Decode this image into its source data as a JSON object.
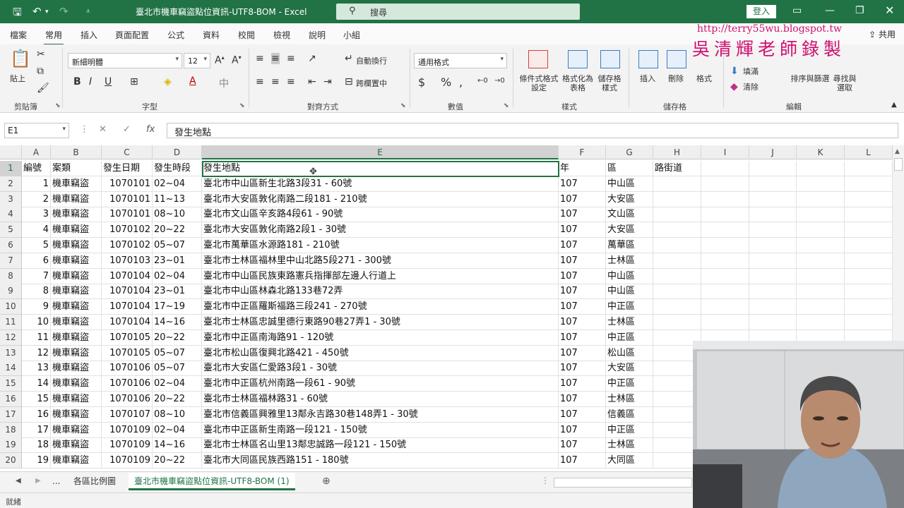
{
  "titlebar": {
    "title": "臺北市機車竊盜點位資訊-UTF8-BOM  -  Excel",
    "search_placeholder": "搜尋",
    "login": "登入"
  },
  "tabs": [
    "檔案",
    "常用",
    "插入",
    "頁面配置",
    "公式",
    "資料",
    "校閱",
    "檢視",
    "說明",
    "小組"
  ],
  "share": "共用",
  "ribbon": {
    "paste": "貼上",
    "clipboard": "剪貼簿",
    "font_name": "新細明體",
    "font_size": "12",
    "font_group": "字型",
    "wrap_text": "自動換行",
    "merge_center": "跨欄置中",
    "alignment": "對齊方式",
    "number_format": "通用格式",
    "number": "數值",
    "cond_format": "條件式格式設定",
    "format_table": "格式化為表格",
    "cell_styles": "儲存格樣式",
    "styles": "樣式",
    "insert": "插入",
    "delete": "刪除",
    "format": "格式",
    "cells": "儲存格",
    "fill": "填滿",
    "clear": "清除",
    "sort_filter": "排序與篩選",
    "find_select": "尋找與選取",
    "editing": "編輯"
  },
  "watermark": {
    "url": "http://terry55wu.blogspot.tw",
    "text": "吳清輝老師錄製"
  },
  "formula_bar": {
    "name_box": "E1",
    "content": "發生地點"
  },
  "columns": [
    "A",
    "B",
    "C",
    "D",
    "E",
    "F",
    "G",
    "H",
    "I",
    "J",
    "K",
    "L"
  ],
  "rows": [
    {
      "n": "1",
      "a": "編號",
      "b": "案類",
      "c": "發生日期",
      "d": "發生時段",
      "e": "發生地點",
      "f": "年",
      "g": "區",
      "h": "路街道"
    },
    {
      "n": "2",
      "a": "1",
      "b": "機車竊盜",
      "c": "1070101",
      "d": "02~04",
      "e": "臺北市中山區新生北路3段31 - 60號",
      "f": "107",
      "g": "中山區",
      "h": ""
    },
    {
      "n": "3",
      "a": "2",
      "b": "機車竊盜",
      "c": "1070101",
      "d": "11~13",
      "e": "臺北市大安區敦化南路二段181 - 210號",
      "f": "107",
      "g": "大安區",
      "h": ""
    },
    {
      "n": "4",
      "a": "3",
      "b": "機車竊盜",
      "c": "1070101",
      "d": "08~10",
      "e": "臺北市文山區辛亥路4段61 - 90號",
      "f": "107",
      "g": "文山區",
      "h": ""
    },
    {
      "n": "5",
      "a": "4",
      "b": "機車竊盜",
      "c": "1070102",
      "d": "20~22",
      "e": "臺北市大安區敦化南路2段1 - 30號",
      "f": "107",
      "g": "大安區",
      "h": ""
    },
    {
      "n": "6",
      "a": "5",
      "b": "機車竊盜",
      "c": "1070102",
      "d": "05~07",
      "e": "臺北市萬華區水源路181 - 210號",
      "f": "107",
      "g": "萬華區",
      "h": ""
    },
    {
      "n": "7",
      "a": "6",
      "b": "機車竊盜",
      "c": "1070103",
      "d": "23~01",
      "e": "臺北市士林區福林里中山北路5段271 - 300號",
      "f": "107",
      "g": "士林區",
      "h": ""
    },
    {
      "n": "8",
      "a": "7",
      "b": "機車竊盜",
      "c": "1070104",
      "d": "02~04",
      "e": "臺北市中山區民族東路憲兵指揮部左邊人行道上",
      "f": "107",
      "g": "中山區",
      "h": ""
    },
    {
      "n": "9",
      "a": "8",
      "b": "機車竊盜",
      "c": "1070104",
      "d": "23~01",
      "e": "臺北市中山區林森北路133巷72弄",
      "f": "107",
      "g": "中山區",
      "h": ""
    },
    {
      "n": "10",
      "a": "9",
      "b": "機車竊盜",
      "c": "1070104",
      "d": "17~19",
      "e": "臺北市中正區羅斯福路三段241 - 270號",
      "f": "107",
      "g": "中正區",
      "h": ""
    },
    {
      "n": "11",
      "a": "10",
      "b": "機車竊盜",
      "c": "1070104",
      "d": "14~16",
      "e": "臺北市士林區忠誠里德行東路90巷27弄1 - 30號",
      "f": "107",
      "g": "士林區",
      "h": ""
    },
    {
      "n": "12",
      "a": "11",
      "b": "機車竊盜",
      "c": "1070105",
      "d": "20~22",
      "e": "臺北市中正區南海路91 - 120號",
      "f": "107",
      "g": "中正區",
      "h": ""
    },
    {
      "n": "13",
      "a": "12",
      "b": "機車竊盜",
      "c": "1070105",
      "d": "05~07",
      "e": "臺北市松山區復興北路421 - 450號",
      "f": "107",
      "g": "松山區",
      "h": ""
    },
    {
      "n": "14",
      "a": "13",
      "b": "機車竊盜",
      "c": "1070106",
      "d": "05~07",
      "e": "臺北市大安區仁愛路3段1 - 30號",
      "f": "107",
      "g": "大安區",
      "h": ""
    },
    {
      "n": "15",
      "a": "14",
      "b": "機車竊盜",
      "c": "1070106",
      "d": "02~04",
      "e": "臺北市中正區杭州南路一段61 - 90號",
      "f": "107",
      "g": "中正區",
      "h": ""
    },
    {
      "n": "16",
      "a": "15",
      "b": "機車竊盜",
      "c": "1070106",
      "d": "20~22",
      "e": "臺北市士林區福林路31 - 60號",
      "f": "107",
      "g": "士林區",
      "h": ""
    },
    {
      "n": "17",
      "a": "16",
      "b": "機車竊盜",
      "c": "1070107",
      "d": "08~10",
      "e": "臺北市信義區興雅里13鄰永吉路30巷148弄1 - 30號",
      "f": "107",
      "g": "信義區",
      "h": ""
    },
    {
      "n": "18",
      "a": "17",
      "b": "機車竊盜",
      "c": "1070109",
      "d": "02~04",
      "e": "臺北市中正區新生南路一段121 - 150號",
      "f": "107",
      "g": "中正區",
      "h": ""
    },
    {
      "n": "19",
      "a": "18",
      "b": "機車竊盜",
      "c": "1070109",
      "d": "14~16",
      "e": "臺北市士林區名山里13鄰忠誠路一段121 - 150號",
      "f": "107",
      "g": "士林區",
      "h": ""
    },
    {
      "n": "20",
      "a": "19",
      "b": "機車竊盜",
      "c": "1070109",
      "d": "20~22",
      "e": "臺北市大同區民族西路151 - 180號",
      "f": "107",
      "g": "大同區",
      "h": ""
    }
  ],
  "sheet_tabs": {
    "more": "...",
    "tab1": "各區比例圖",
    "tab2": "臺北市機車竊盜點位資訊-UTF8-BOM (1)"
  },
  "status": "就緒"
}
